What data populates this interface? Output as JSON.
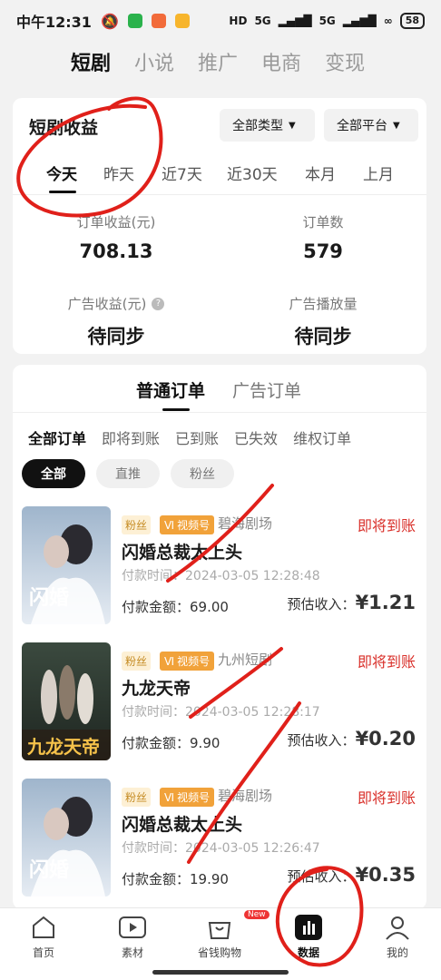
{
  "status_bar": {
    "time": "中午12:31",
    "network": "5G",
    "battery": "58"
  },
  "top_tabs": [
    "短剧",
    "小说",
    "推广",
    "电商",
    "变现"
  ],
  "income": {
    "title": "短剧收益",
    "type_filter": "全部类型",
    "platform_filter": "全部平台",
    "ranges": [
      "今天",
      "昨天",
      "近7天",
      "近30天",
      "本月",
      "上月"
    ],
    "stats": [
      {
        "label": "订单收益(元)",
        "value": "708.13"
      },
      {
        "label": "订单数",
        "value": "579"
      },
      {
        "label": "广告收益(元)",
        "value": "待同步"
      },
      {
        "label": "广告播放量",
        "value": "待同步"
      }
    ]
  },
  "orders": {
    "tabs": [
      "普通订单",
      "广告订单"
    ],
    "status_tabs": [
      "全部订单",
      "即将到账",
      "已到账",
      "已失效",
      "维权订单"
    ],
    "pills": [
      "全部",
      "直推",
      "粉丝"
    ],
    "pay_label": "付款金额：",
    "est_label": "预估收入：",
    "time_label": "付款时间：",
    "tag_fan": "粉丝",
    "tag_channel": "视频号",
    "items": [
      {
        "theatre": "碧海剧场",
        "status": "即将到账",
        "title": "闪婚总裁太上头",
        "time": "2024-03-05 12:28:48",
        "pay": "69.00",
        "est": "¥1.21"
      },
      {
        "theatre": "九州短剧",
        "status": "即将到账",
        "title": "九龙天帝",
        "time": "2024-03-05 12:28:17",
        "pay": "9.90",
        "est": "¥0.20"
      },
      {
        "theatre": "碧海剧场",
        "status": "即将到账",
        "title": "闪婚总裁太上头",
        "time": "2024-03-05 12:26:47",
        "pay": "19.90",
        "est": "¥0.35"
      }
    ]
  },
  "bottom_nav": [
    "首页",
    "素材",
    "省钱购物",
    "数据",
    "我的"
  ],
  "new_badge": "New",
  "colors": {
    "accent_red": "#d9302a",
    "tag_orange": "#f1a23a"
  }
}
